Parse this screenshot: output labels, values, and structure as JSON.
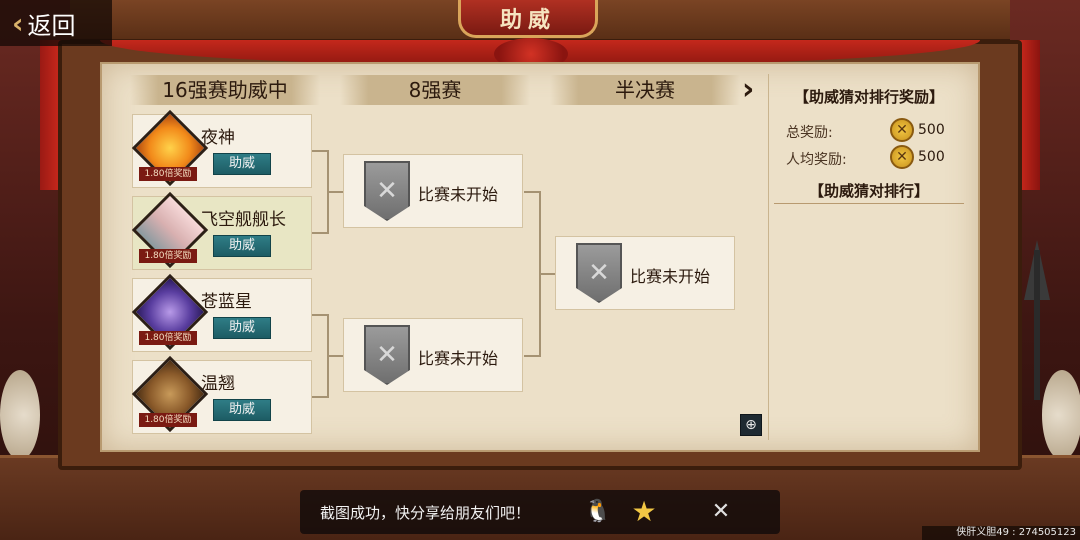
{
  "header": {
    "back_label": "返回",
    "title": "助威"
  },
  "rounds": [
    {
      "label": "16强赛助威中"
    },
    {
      "label": "8强赛"
    },
    {
      "label": "半决赛"
    }
  ],
  "players": [
    {
      "name": "夜神",
      "odds": "1.80倍奖励",
      "support_label": "助威",
      "avatar": "fire-card-avatar",
      "highlighted": false
    },
    {
      "name": "飞空舰舰长",
      "odds": "1.80倍奖励",
      "support_label": "助威",
      "avatar": "captain-avatar",
      "highlighted": true
    },
    {
      "name": "苍蓝星",
      "odds": "1.80倍奖励",
      "support_label": "助威",
      "avatar": "blue-star-avatar",
      "highlighted": false
    },
    {
      "name": "温翘",
      "odds": "1.80倍奖励",
      "support_label": "助威",
      "avatar": "animal-avatar",
      "highlighted": false
    }
  ],
  "matches": [
    {
      "status": "比赛未开始"
    },
    {
      "status": "比赛未开始"
    },
    {
      "status": "比赛未开始"
    }
  ],
  "reward_panel": {
    "title": "【助威猜对排行奖励】",
    "total_label": "总奖励:",
    "total_amount": "500",
    "per_label": "人均奖励:",
    "per_amount": "500",
    "ranking_title": "【助威猜对排行】"
  },
  "share": {
    "message": "截图成功，快分享给朋友们吧！"
  },
  "watermark": "侠肝义胆49 : 274505123",
  "colors": {
    "support_button": "#2f7d86",
    "odds_tag": "#7a1a12",
    "parchment": "#ece0c8"
  }
}
